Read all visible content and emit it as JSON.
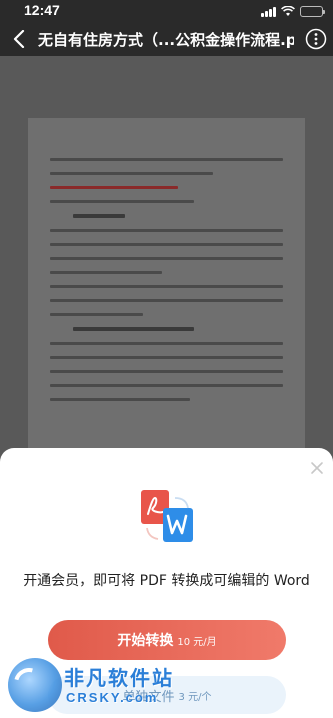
{
  "status_bar": {
    "time": "12:47"
  },
  "nav": {
    "title": "无自有住房方式（...公积金操作流程.pdf"
  },
  "sheet": {
    "title": "开通会员，即可将 PDF 转换成可编辑的 Word",
    "convert_label": "开始转换",
    "convert_price": "10 元/月",
    "single_label": "单独文件",
    "single_price": "3 元/个"
  },
  "watermark": {
    "title": "非凡软件站",
    "subtitle": "CRSKY.com"
  },
  "colors": {
    "accent_red": "#e05a4a",
    "secondary_blue": "#eaf3fb",
    "pdf_icon_red": "#e8554a",
    "word_icon_blue": "#2e8de8"
  },
  "icons": [
    "back-icon",
    "more-icon",
    "close-icon",
    "pdf-icon",
    "word-icon",
    "signal-icon",
    "wifi-icon",
    "battery-icon"
  ]
}
